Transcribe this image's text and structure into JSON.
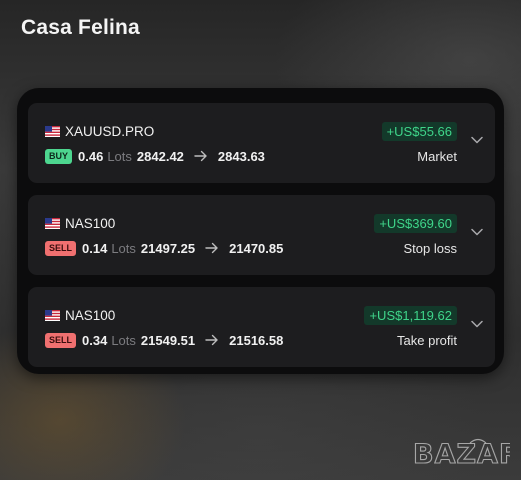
{
  "header": {
    "title": "Casa Felina"
  },
  "colors": {
    "profit": "#3fd58a",
    "buy": "#4dd68f",
    "sell": "#f07070",
    "card": "#1d1d1f",
    "panel": "#0c0c0d"
  },
  "positions": [
    {
      "symbol": "XAUUSD.PRO",
      "flag_icon": "us-flag-icon",
      "pnl": "+US$55.66",
      "side": "BUY",
      "lots": "0.46",
      "lots_label": "Lots",
      "open_price": "2842.42",
      "close_price": "2843.63",
      "close_reason": "Market"
    },
    {
      "symbol": "NAS100",
      "flag_icon": "us-flag-icon",
      "pnl": "+US$369.60",
      "side": "SELL",
      "lots": "0.14",
      "lots_label": "Lots",
      "open_price": "21497.25",
      "close_price": "21470.85",
      "close_reason": "Stop loss"
    },
    {
      "symbol": "NAS100",
      "flag_icon": "us-flag-icon",
      "pnl": "+US$1,119.62",
      "side": "SELL",
      "lots": "0.34",
      "lots_label": "Lots",
      "open_price": "21549.51",
      "close_price": "21516.58",
      "close_reason": "Take profit"
    }
  ],
  "watermark": {
    "text": "BAZAR"
  }
}
